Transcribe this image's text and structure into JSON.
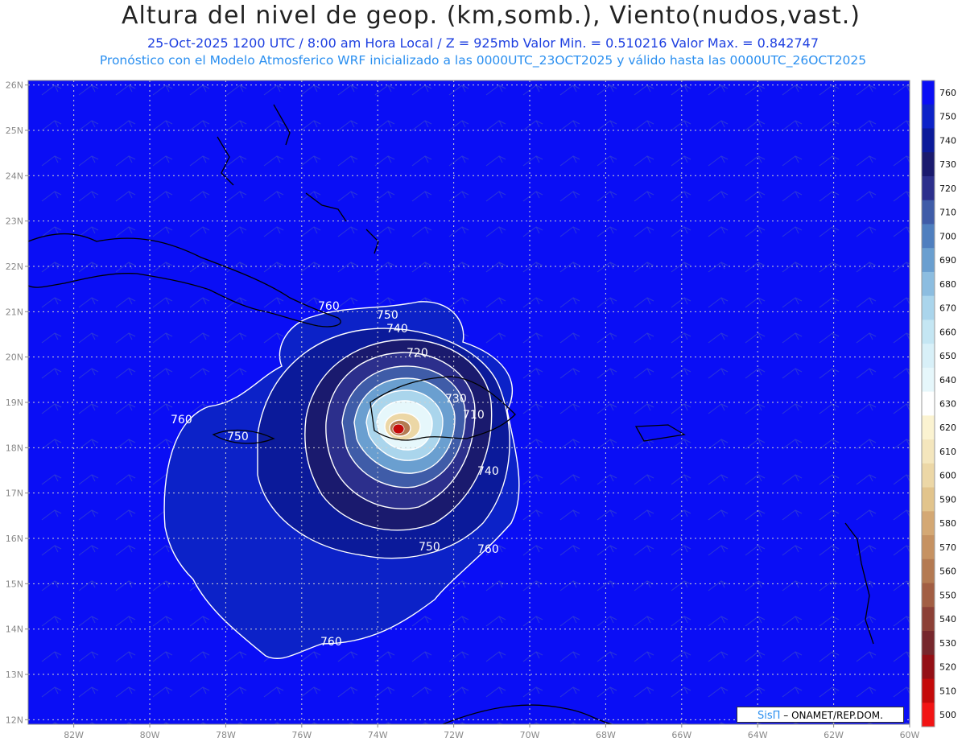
{
  "header": {
    "title": "Altura del nivel de geop. (km,somb.), Viento(nudos,vast.)",
    "subtitle_line1": "25-Oct-2025   1200 UTC / 8:00 am Hora Local / Z = 925mb   Valor Min. = 0.510216   Valor Max. = 0.842747",
    "subtitle_line2": "Pronóstico con el Modelo Atmosferico WRF inicializado a las 0000UTC_23OCT2025 y válido hasta las  0000UTC_26OCT2025"
  },
  "map": {
    "lon_range": [
      -83.2,
      -60
    ],
    "lat_range": [
      11.9,
      26.1
    ],
    "lat_ticks": [
      "26N",
      "25N",
      "24N",
      "23N",
      "22N",
      "21N",
      "20N",
      "19N",
      "18N",
      "17N",
      "16N",
      "15N",
      "14N",
      "13N",
      "12N"
    ],
    "lon_ticks": [
      "82W",
      "80W",
      "78W",
      "76W",
      "74W",
      "72W",
      "70W",
      "68W",
      "66W",
      "64W",
      "62W",
      "60W"
    ],
    "grid": "dotted",
    "contour_labels": [
      "760",
      "750",
      "740",
      "720",
      "730",
      "710",
      "760",
      "750",
      "740",
      "750",
      "760",
      "760"
    ],
    "center": {
      "lon": -73.4,
      "lat": 18.45
    }
  },
  "colorbar": {
    "levels": [
      "760",
      "750",
      "740",
      "730",
      "720",
      "710",
      "700",
      "690",
      "680",
      "670",
      "660",
      "650",
      "640",
      "630",
      "620",
      "610",
      "600",
      "590",
      "580",
      "570",
      "560",
      "550",
      "540",
      "530",
      "520",
      "510",
      "500"
    ],
    "colors": [
      "#0a0ef5",
      "#0c22c8",
      "#0b1a9a",
      "#1a1a6e",
      "#2c2f8c",
      "#3f5ca8",
      "#4f7fbf",
      "#6a9fd0",
      "#8cbde0",
      "#aad5ec",
      "#c4e6f3",
      "#d8f0f8",
      "#e6f7fb",
      "#ffffff",
      "#fbf3d1",
      "#f4e6bd",
      "#ecd7a6",
      "#e2c48c",
      "#d4a874",
      "#c69262",
      "#b47a52",
      "#a25e43",
      "#8c4036",
      "#76272c",
      "#940f15",
      "#c40a0a",
      "#f21414"
    ]
  },
  "credit": {
    "brand": "SisΠ",
    "text": "– ONAMET/REP.DOM."
  }
}
